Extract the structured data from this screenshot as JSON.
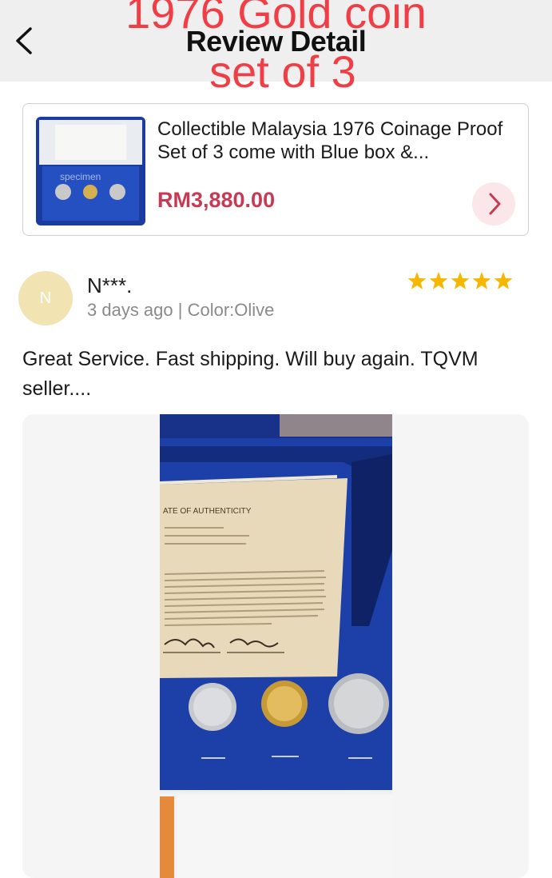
{
  "header": {
    "title": "Review Detail",
    "back_icon": "chevron-left-icon",
    "overlay_line1": "1976 Gold coin",
    "overlay_line2": "set of 3",
    "overlay_color": "#ef3e46",
    "background": "#efefef"
  },
  "product": {
    "name": "Collectible Malaysia 1976 Coinage Proof Set of 3 come with Blue box &...",
    "price": "RM3,880.00",
    "price_color": "#c83a54",
    "thumb_specimen_text": "specimen",
    "arrow_icon": "chevron-right-icon"
  },
  "review": {
    "avatar_initial": "N",
    "reviewer_name": "N***.",
    "meta": "3 days ago | Color:Olive",
    "rating": 5,
    "star_color": "#f5b700",
    "text": "Great Service. Fast shipping. Will buy again. TQVM seller....",
    "photo": {
      "certificate_title": "ATE OF AUTHENTICITY",
      "box_color": "#1d3fa8"
    }
  }
}
